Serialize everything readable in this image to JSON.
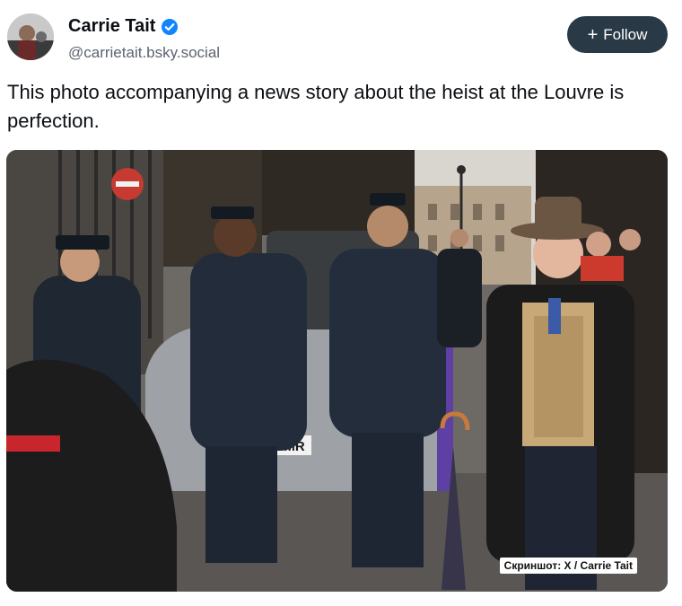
{
  "post": {
    "author": {
      "name": "Carrie Tait",
      "handle": "@carrietait.bsky.social",
      "verified": true
    },
    "follow_label": "Follow",
    "text": "This photo accompanying a news story about the heist at the Louvre is perfection.",
    "image": {
      "plate_text": "9-MR",
      "caption": "Скриншот: X / Carrie Tait"
    }
  },
  "colors": {
    "follow_bg": "#2a3946",
    "verified": "#1185fe",
    "text": "#0b0f14",
    "handle": "#5b6470"
  },
  "icons": [
    "verified-badge-icon",
    "plus-icon"
  ]
}
